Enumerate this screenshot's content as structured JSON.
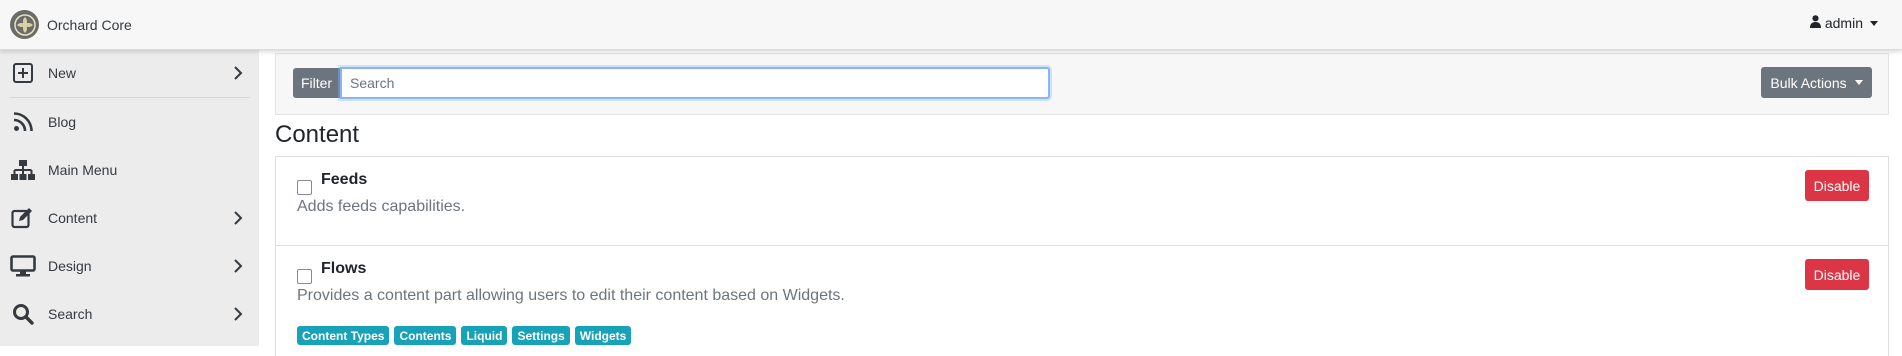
{
  "brand": {
    "name": "Orchard Core"
  },
  "user": {
    "name": "admin"
  },
  "sidebar": {
    "items": [
      {
        "label": "New",
        "has_submenu": true
      },
      {
        "label": "Blog",
        "has_submenu": false
      },
      {
        "label": "Main Menu",
        "has_submenu": false
      },
      {
        "label": "Content",
        "has_submenu": true
      },
      {
        "label": "Design",
        "has_submenu": true
      },
      {
        "label": "Search",
        "has_submenu": true
      }
    ]
  },
  "filter": {
    "label": "Filter",
    "search_placeholder": "Search",
    "search_value": "",
    "bulk_actions_label": "Bulk Actions"
  },
  "page": {
    "title": "Content"
  },
  "features": [
    {
      "title": "Feeds",
      "description": "Adds feeds capabilities.",
      "action_label": "Disable",
      "dependencies": []
    },
    {
      "title": "Flows",
      "description": "Provides a content part allowing users to edit their content based on Widgets.",
      "action_label": "Disable",
      "dependencies": [
        "Content Types",
        "Contents",
        "Liquid",
        "Settings",
        "Widgets"
      ]
    }
  ],
  "colors": {
    "danger": "#dc3545",
    "secondary": "#6c757d",
    "info": "#17a2b8",
    "sidebar_bg": "#ececec"
  }
}
